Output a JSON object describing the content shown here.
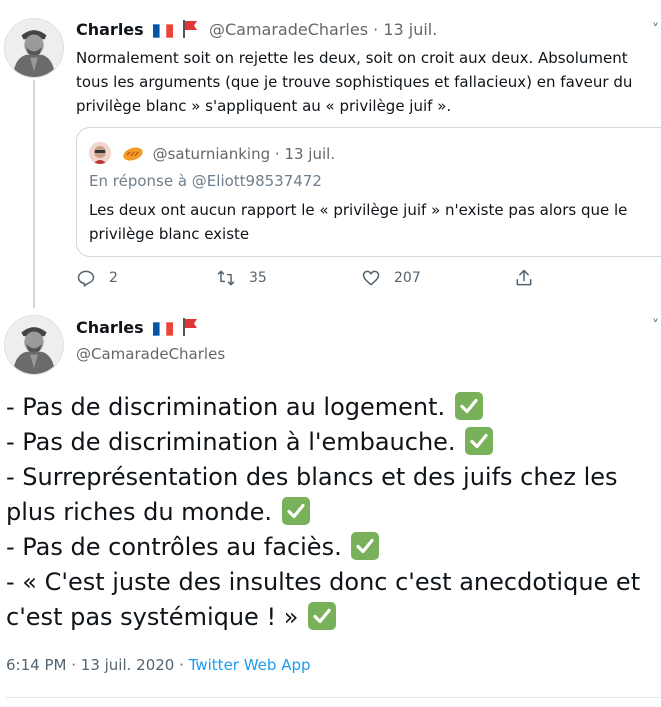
{
  "tweet1": {
    "author_name": "Charles",
    "handle": "@CamaradeCharles",
    "date": "13 juil.",
    "text_lines": [
      "Normalement soit on rejette les deux, soit on croit aux deux. Absolument",
      "tous les arguments (que je trouve sophistiques et fallacieux) en faveur du",
      "privilège blanc »  s'appliquent au « privilège juif »."
    ],
    "quote": {
      "handle": "@saturnianking",
      "date": "13 juil.",
      "reply_to": "En réponse à @Eliott98537472",
      "text": "Les deux ont aucun rapport le « privilège juif » n'existe pas alors que le privilège blanc existe"
    },
    "actions": {
      "replies": "2",
      "retweets": "35",
      "likes": "207"
    }
  },
  "tweet2": {
    "author_name": "Charles",
    "handle": "@CamaradeCharles",
    "lines": [
      "- Pas de discrimination au logement.",
      "- Pas de discrimination à l'embauche.",
      "- Surreprésentation des blancs et des juifs chez les",
      "plus riches du monde.",
      "- Pas de contrôles au faciès.",
      "- « C'est juste des insultes donc c'est anecdotique et",
      "c'est pas systémique ! »"
    ],
    "time": "6:14 PM",
    "date": "13 juil. 2020",
    "source": "Twitter Web App"
  },
  "icons": {
    "flag_colors": [
      "#0055a4",
      "#ffffff",
      "#ef4135"
    ],
    "red_flag": "#e0363a",
    "check_bg": "#78b159"
  }
}
